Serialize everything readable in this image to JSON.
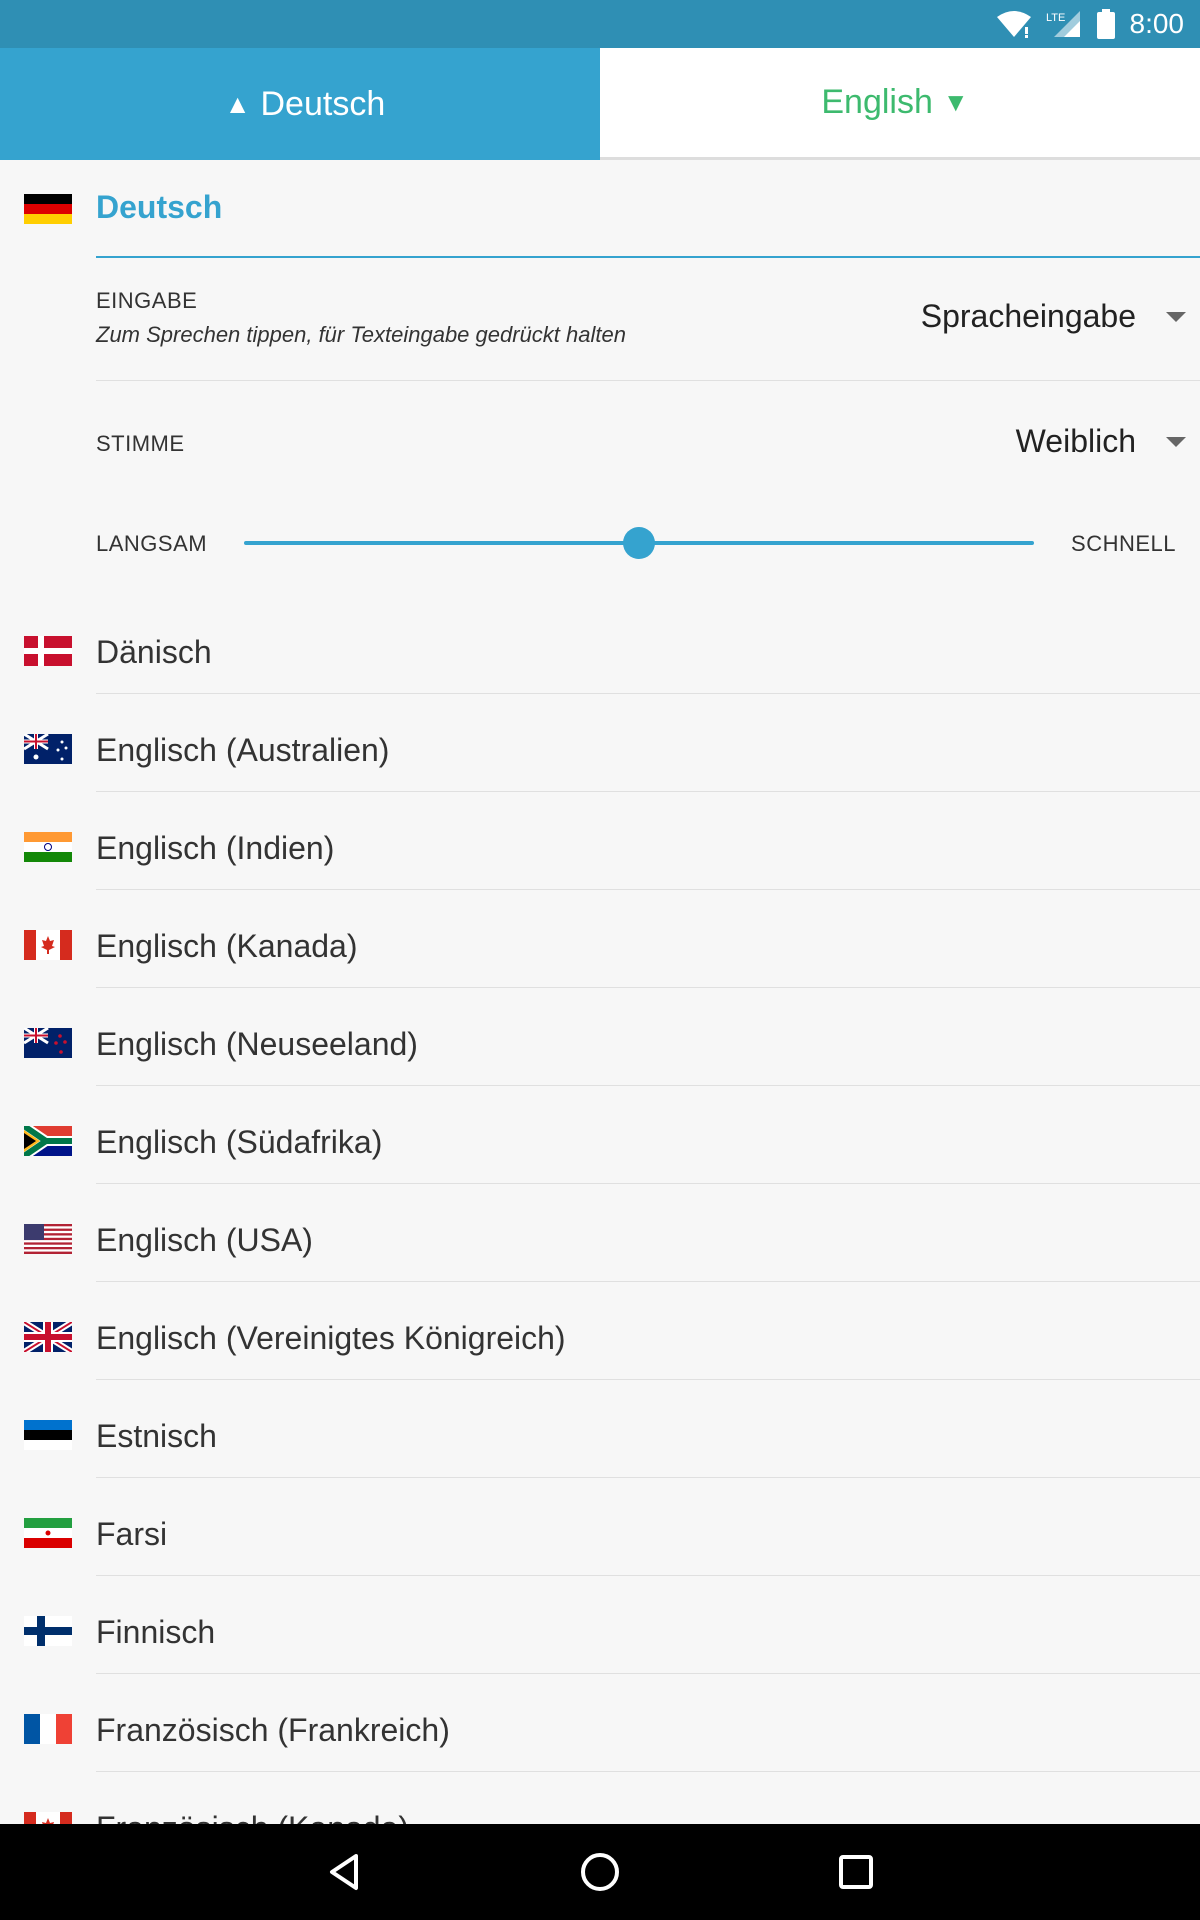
{
  "status_bar": {
    "time": "8:00",
    "network": "LTE"
  },
  "tabs": {
    "source_label": "Deutsch",
    "target_label": "English"
  },
  "colors": {
    "accent": "#35a3cf",
    "target_tab_text": "#3dba6e",
    "status_bar": "#2f8fb4"
  },
  "selected_language": {
    "name": "Deutsch",
    "flag": "flag-germany",
    "input": {
      "label": "EINGABE",
      "hint": "Zum Sprechen tippen, für Texteingabe gedrückt halten",
      "value": "Spracheingabe"
    },
    "voice": {
      "label": "STIMME",
      "value": "Weiblich"
    },
    "speed": {
      "slow_label": "LANGSAM",
      "fast_label": "SCHNELL",
      "value": 0.5
    }
  },
  "languages": [
    {
      "name": "Dänisch",
      "flag": "flag-denmark"
    },
    {
      "name": "Englisch (Australien)",
      "flag": "flag-australia"
    },
    {
      "name": "Englisch (Indien)",
      "flag": "flag-india"
    },
    {
      "name": "Englisch (Kanada)",
      "flag": "flag-canada"
    },
    {
      "name": "Englisch (Neuseeland)",
      "flag": "flag-new-zealand"
    },
    {
      "name": "Englisch (Südafrika)",
      "flag": "flag-south-africa"
    },
    {
      "name": "Englisch (USA)",
      "flag": "flag-usa"
    },
    {
      "name": "Englisch (Vereinigtes Königreich)",
      "flag": "flag-uk"
    },
    {
      "name": "Estnisch",
      "flag": "flag-estonia"
    },
    {
      "name": "Farsi",
      "flag": "flag-iran"
    },
    {
      "name": "Finnisch",
      "flag": "flag-finland"
    },
    {
      "name": "Französisch (Frankreich)",
      "flag": "flag-france"
    },
    {
      "name": "Französisch (Kanada)",
      "flag": "flag-canada"
    }
  ],
  "nav": {
    "back_icon": "back-icon",
    "home_icon": "home-icon",
    "recents_icon": "recents-icon"
  }
}
